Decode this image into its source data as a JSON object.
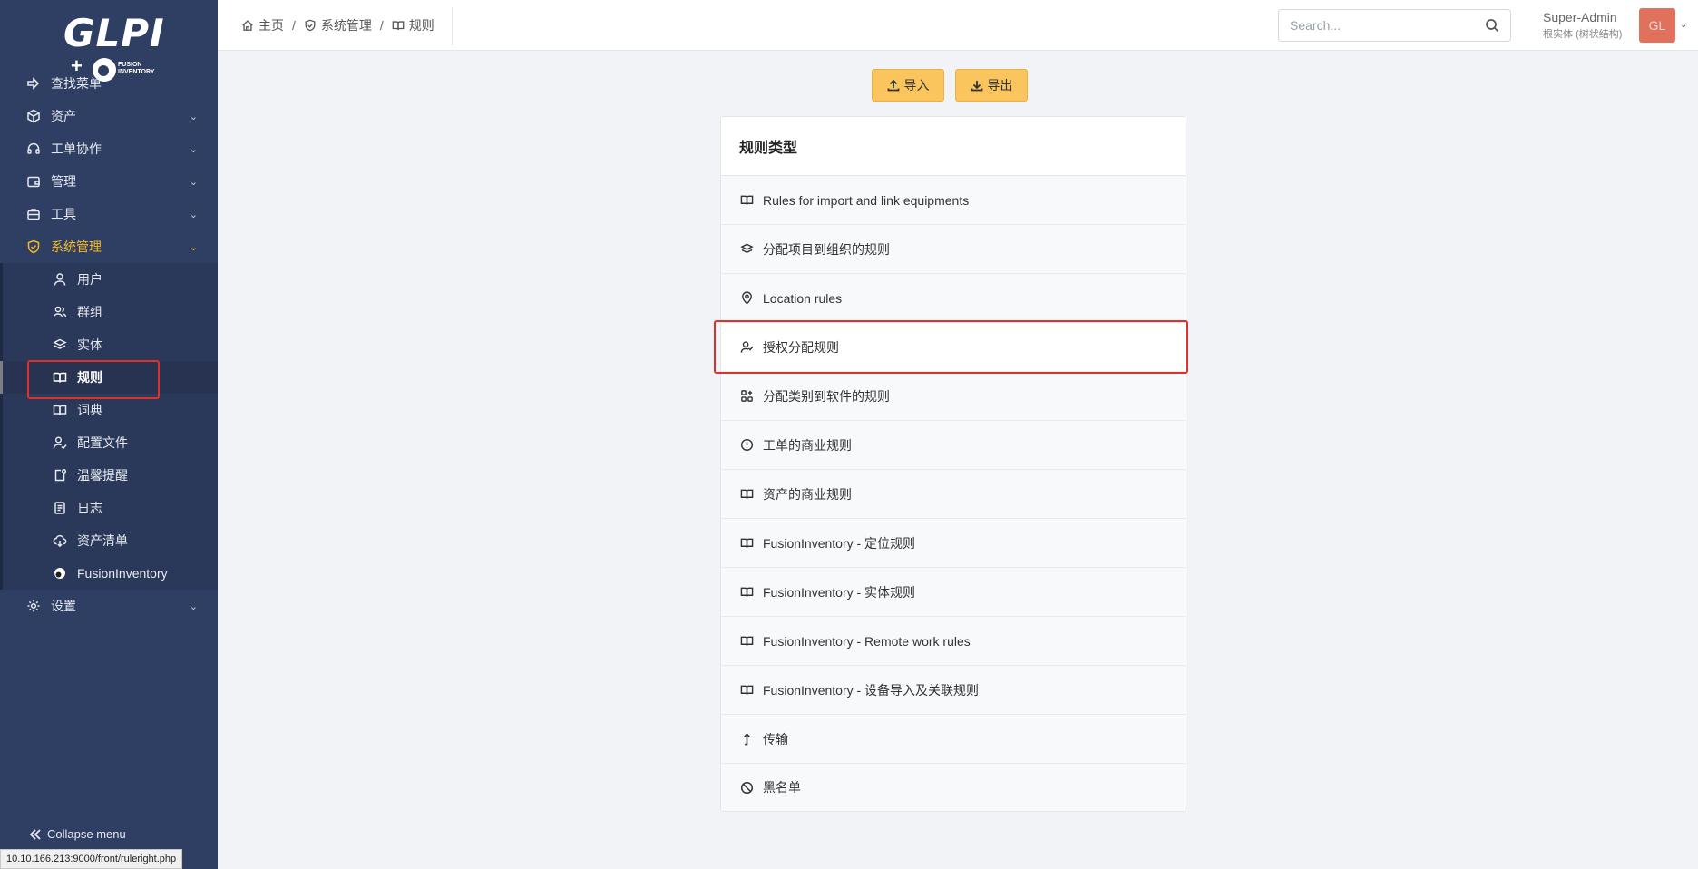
{
  "sidebar": {
    "logo": {
      "brand": "GLPI",
      "plus": "+",
      "addon_line1": "FUSION",
      "addon_line2": "INVENTORY"
    },
    "items": [
      {
        "label": "查找菜单",
        "icon": "arrow-right-icon"
      },
      {
        "label": "资产",
        "icon": "cube-icon"
      },
      {
        "label": "工单协作",
        "icon": "headset-icon"
      },
      {
        "label": "管理",
        "icon": "wallet-icon"
      },
      {
        "label": "工具",
        "icon": "briefcase-icon"
      },
      {
        "label": "系统管理",
        "icon": "shield-check-icon"
      },
      {
        "label": "设置",
        "icon": "gear-icon"
      }
    ],
    "admin_subitems": [
      {
        "label": "用户",
        "icon": "user-icon"
      },
      {
        "label": "群组",
        "icon": "users-icon"
      },
      {
        "label": "实体",
        "icon": "stack-icon"
      },
      {
        "label": "规则",
        "icon": "book-icon"
      },
      {
        "label": "词典",
        "icon": "book-icon"
      },
      {
        "label": "配置文件",
        "icon": "user-check-icon"
      },
      {
        "label": "温馨提醒",
        "icon": "note-icon"
      },
      {
        "label": "日志",
        "icon": "log-icon"
      },
      {
        "label": "资产清单",
        "icon": "cloud-download-icon"
      },
      {
        "label": "FusionInventory",
        "icon": "fusion-icon"
      }
    ],
    "collapse_label": "Collapse menu"
  },
  "header": {
    "breadcrumbs": [
      {
        "label": "主页",
        "icon": "home-icon"
      },
      {
        "label": "系统管理",
        "icon": "shield-check-icon"
      },
      {
        "label": "规则",
        "icon": "book-icon"
      }
    ],
    "breadcrumb_separator": "/",
    "search_placeholder": "Search...",
    "user_name": "Super-Admin",
    "user_entity": "根实体 (树状结构)",
    "avatar_initials": "GL"
  },
  "actions": {
    "import_label": "导入",
    "export_label": "导出"
  },
  "card": {
    "title": "规则类型",
    "rows": [
      {
        "label": "Rules for import and link equipments",
        "icon": "book-icon"
      },
      {
        "label": "分配项目到组织的规则",
        "icon": "stack-icon"
      },
      {
        "label": "Location rules",
        "icon": "map-pin-icon"
      },
      {
        "label": "授权分配规则",
        "icon": "user-check-icon"
      },
      {
        "label": "分配类别到软件的规则",
        "icon": "apps-icon"
      },
      {
        "label": "工单的商业规则",
        "icon": "alert-circle-icon"
      },
      {
        "label": "资产的商业规则",
        "icon": "book-icon"
      },
      {
        "label": "FusionInventory - 定位规则",
        "icon": "book-icon"
      },
      {
        "label": "FusionInventory - 实体规则",
        "icon": "book-icon"
      },
      {
        "label": "FusionInventory - Remote work rules",
        "icon": "book-icon"
      },
      {
        "label": "FusionInventory - 设备导入及关联规则",
        "icon": "book-icon"
      },
      {
        "label": "传输",
        "icon": "arrow-up-corner-icon"
      },
      {
        "label": "黑名单",
        "icon": "ban-icon"
      }
    ]
  },
  "statusbar_url": "10.10.166.213:9000/front/ruleright.php",
  "colors": {
    "sidebar_bg": "#2f3f64",
    "accent": "#f7b924",
    "button": "#fac55c",
    "highlight": "#e0302a",
    "avatar": "#e1705c"
  }
}
